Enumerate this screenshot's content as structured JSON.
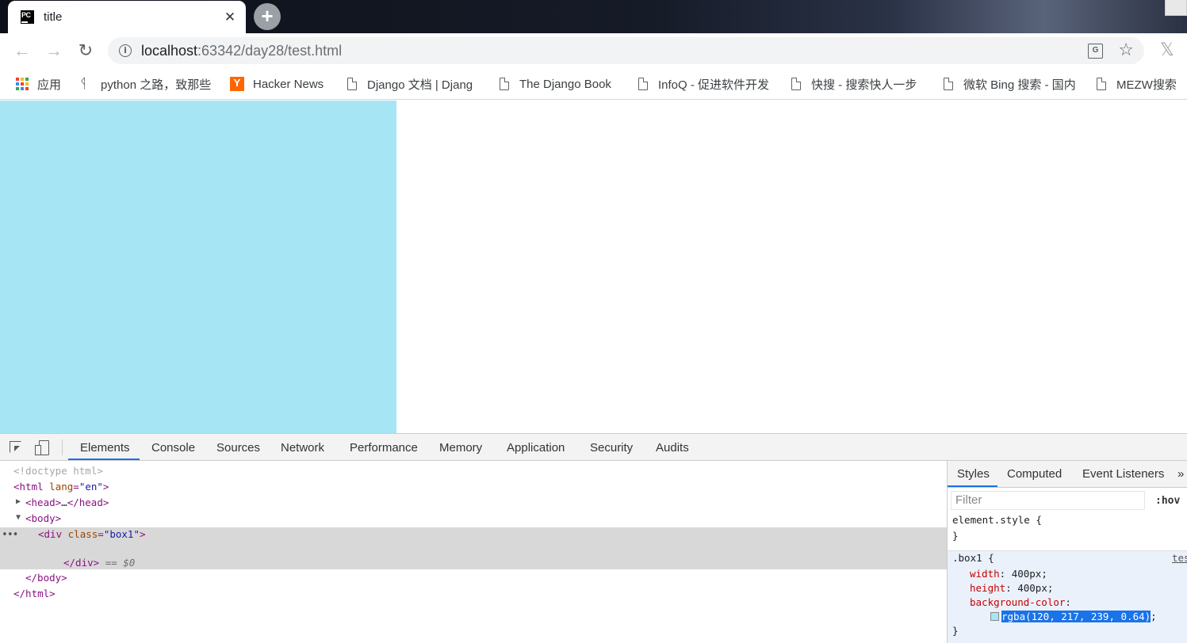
{
  "browser": {
    "tab_title": "title",
    "favicon_text": "PC",
    "url_host": "localhost",
    "url_rest": ":63342/day28/test.html",
    "new_tab_glyph": "+",
    "close_glyph": "✕",
    "nav": {
      "back": "←",
      "forward": "→",
      "reload": "↻",
      "star": "☆",
      "ext": "𝕏"
    }
  },
  "bookmarks": [
    {
      "label": "应用",
      "icon": "apps-grid-icon"
    },
    {
      "label": "python 之路，致那些",
      "icon": "python-icon"
    },
    {
      "label": "Hacker News",
      "icon": "ycombinator-icon"
    },
    {
      "label": "Django 文档 | Djang",
      "icon": "page-icon"
    },
    {
      "label": "The Django Book",
      "icon": "page-icon"
    },
    {
      "label": "InfoQ - 促进软件开发",
      "icon": "page-icon"
    },
    {
      "label": "快搜 - 搜索快人一步",
      "icon": "page-icon"
    },
    {
      "label": "微软 Bing 搜索 - 国内",
      "icon": "page-icon"
    },
    {
      "label": "MEZW搜索",
      "icon": "page-icon"
    }
  ],
  "page": {
    "box1_color": "#a6e6f4"
  },
  "devtools": {
    "tabs": [
      "Elements",
      "Console",
      "Sources",
      "Network",
      "Performance",
      "Memory",
      "Application",
      "Security",
      "Audits"
    ],
    "active_tab": "Elements",
    "dom": {
      "doctype": "<!doctype html>",
      "html_open_tag": "<html",
      "html_attr": "lang",
      "html_val": "\"en\"",
      "html_close_bracket": ">",
      "head": "<head>",
      "head_ellipsis": "…",
      "head_close": "</head>",
      "body": "<body>",
      "div_open": "<div",
      "div_attr": "class",
      "div_val": "\"box1\"",
      "div_close_bracket": ">",
      "div_end": "</div>",
      "selected_marker": "== $0",
      "body_close": "</body>",
      "html_close": "</html>",
      "eq": "=",
      "dots": "•••"
    },
    "styles": {
      "tabs": [
        "Styles",
        "Computed",
        "Event Listeners"
      ],
      "more": "»",
      "filter_placeholder": "Filter",
      "hov": ":hov",
      "element_style": "element.style {",
      "close_brace": "}",
      "selector": ".box1 {",
      "source": "tes",
      "props": [
        {
          "name": "width",
          "value": "400px"
        },
        {
          "name": "height",
          "value": "400px"
        },
        {
          "name": "background-color",
          "value": ""
        }
      ],
      "bg_value": "rgba(120, 217, 239, 0.64)",
      "colon": ":",
      "semicolon": ";"
    }
  }
}
